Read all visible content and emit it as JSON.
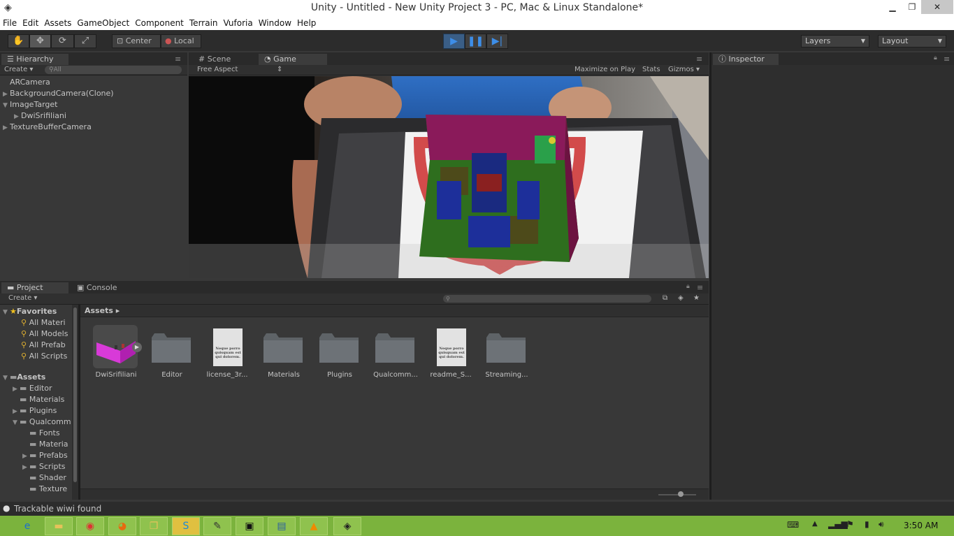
{
  "window": {
    "title": "Unity - Untitled - New Unity Project 3 - PC, Mac & Linux Standalone*",
    "minimize": "▁",
    "maximize": "❐",
    "close": "✕"
  },
  "menu": [
    "File",
    "Edit",
    "Assets",
    "GameObject",
    "Component",
    "Terrain",
    "Vuforia",
    "Window",
    "Help"
  ],
  "toolbar": {
    "tools": [
      "hand-tool-icon",
      "move-tool-icon",
      "rotate-tool-icon",
      "scale-tool-icon"
    ],
    "pivot": "Center",
    "space": "Local",
    "layers": "Layers",
    "layout": "Layout",
    "play_icons": [
      "play-icon",
      "pause-icon",
      "step-icon"
    ]
  },
  "hierarchy": {
    "tab": "Hierarchy",
    "create": "Create",
    "search_placeholder": "All",
    "items": [
      {
        "label": "ARCamera",
        "expander": ""
      },
      {
        "label": "BackgroundCamera(Clone)",
        "expander": "▶"
      },
      {
        "label": "ImageTarget",
        "expander": "▼"
      },
      {
        "label": "DwiSrifiliani",
        "expander": "▶",
        "indent": 1
      },
      {
        "label": "TextureBufferCamera",
        "expander": "▶"
      }
    ]
  },
  "scene_tabs": {
    "scene": "Scene",
    "game": "Game",
    "aspect": "Free Aspect",
    "maximize": "Maximize on Play",
    "stats": "Stats",
    "gizmos": "Gizmos"
  },
  "inspector": {
    "tab": "Inspector"
  },
  "project": {
    "tab": "Project",
    "console_tab": "Console",
    "create": "Create",
    "favorites_label": "Favorites",
    "favorites": [
      "All Materi",
      "All Models",
      "All Prefab",
      "All Scripts"
    ],
    "assets_label": "Assets",
    "tree": [
      {
        "label": "Editor",
        "level": 1,
        "expander": "▶"
      },
      {
        "label": "Materials",
        "level": 1,
        "expander": ""
      },
      {
        "label": "Plugins",
        "level": 1,
        "expander": "▶"
      },
      {
        "label": "Qualcomm",
        "level": 1,
        "expander": "▼"
      },
      {
        "label": "Fonts",
        "level": 2,
        "expander": ""
      },
      {
        "label": "Materia",
        "level": 2,
        "expander": ""
      },
      {
        "label": "Prefabs",
        "level": 2,
        "expander": "▶"
      },
      {
        "label": "Scripts",
        "level": 2,
        "expander": "▶"
      },
      {
        "label": "Shader",
        "level": 2,
        "expander": ""
      },
      {
        "label": "Texture",
        "level": 2,
        "expander": ""
      }
    ],
    "breadcrumb": "Assets ▸",
    "grid": [
      {
        "label": "DwiSrifiliani",
        "kind": "model"
      },
      {
        "label": "Editor",
        "kind": "folder"
      },
      {
        "label": "license_3r...",
        "kind": "doc"
      },
      {
        "label": "Materials",
        "kind": "folder"
      },
      {
        "label": "Plugins",
        "kind": "folder"
      },
      {
        "label": "Qualcomm...",
        "kind": "folder"
      },
      {
        "label": "readme_S...",
        "kind": "doc"
      },
      {
        "label": "Streaming...",
        "kind": "folder"
      }
    ],
    "doc_text": "Neque porro quisquam est qui dolorem."
  },
  "status": {
    "text": "Trackable wiwi found",
    "icon": "info-icon"
  },
  "taskbar": {
    "icons": [
      "internet-explorer-icon",
      "file-explorer-icon",
      "chrome-icon",
      "firefox-icon",
      "folder-icon",
      "skype-icon",
      "pencil-app-icon",
      "terminal-icon",
      "window-app-icon",
      "vlc-icon",
      "unity-icon"
    ],
    "clock": "3:50 AM"
  },
  "colors": {
    "play_active": "#3a5e86",
    "model_magenta": "#d83ad8",
    "taskbar": "#7bb33d"
  }
}
